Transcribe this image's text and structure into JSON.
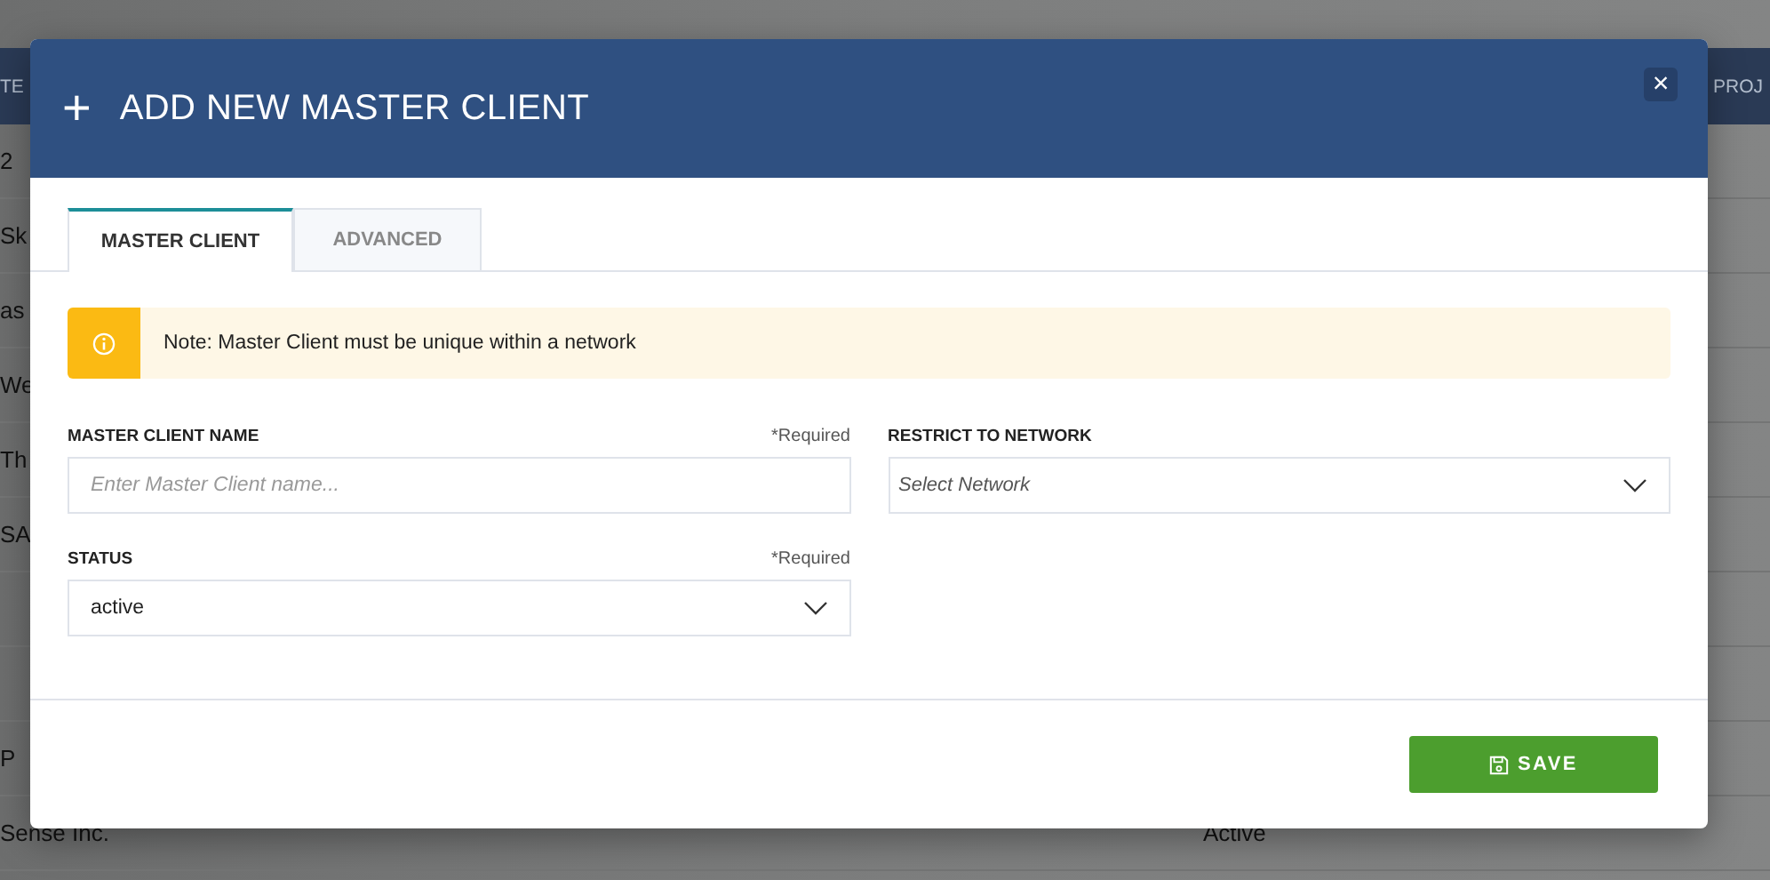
{
  "background_table": {
    "columns": [
      "TE",
      "PROJ"
    ],
    "rows": [
      {
        "column_1": "2"
      },
      {
        "column_1": "Sk"
      },
      {
        "column_1": "as"
      },
      {
        "column_1": "We"
      },
      {
        "column_1": "Th"
      },
      {
        "column_1": "SA"
      },
      {},
      {},
      {
        "column_1": "P"
      },
      {
        "column_1": "Sense Inc.",
        "column_2": "Active"
      }
    ]
  },
  "dialog": {
    "title": "ADD NEW MASTER CLIENT",
    "title_icon": "+",
    "close_icon": "×",
    "tabs": [
      {
        "label": "MASTER CLIENT",
        "selected": true
      },
      {
        "label": "ADVANCED",
        "selected": false
      }
    ],
    "note": "Note: Master Client must be unique within a network",
    "fields": [
      {
        "kind": "text",
        "label": "MASTER CLIENT NAME",
        "required": "*Required",
        "placeholder": "Enter Master Client name..."
      },
      {
        "kind": "select",
        "label": "RESTRICT TO NETWORK",
        "placeholder": "Select Network"
      },
      {
        "kind": "select",
        "label": "STATUS",
        "required": "*Required",
        "value": "active"
      }
    ],
    "save_button": "SAVE"
  }
}
